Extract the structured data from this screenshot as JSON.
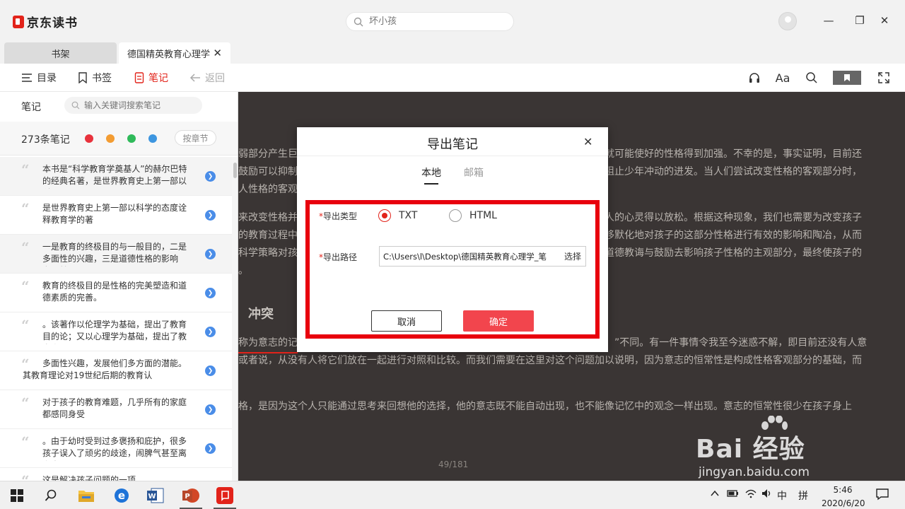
{
  "app": {
    "name": "京东读书",
    "search_placeholder": "坏小孩"
  },
  "window_controls": {
    "minimize": "—",
    "restore": "❐",
    "close": "✕"
  },
  "tabs": [
    {
      "label": "书架"
    },
    {
      "label": "德国精英教育心理学"
    }
  ],
  "toolbar": {
    "toc": "目录",
    "bookmark": "书签",
    "notes": "笔记",
    "back": "返回",
    "font_label": "Aa"
  },
  "sidebar": {
    "title": "笔记",
    "search_placeholder": "输入关键词搜索笔记",
    "count": "273条笔记",
    "chapter_button": "按章节",
    "dot_colors": [
      "#e8323c",
      "#f39c32",
      "#2fba5a",
      "#3d96e0"
    ],
    "notes": [
      {
        "text": "本书是“科学教育学奠基人”的赫尔巴特的经典名著，是世界教育史上第一部以科…",
        "highlight": true,
        "wide": false
      },
      {
        "text": "是世界教育史上第一部以科学的态度诠释教育学的著",
        "highlight": false,
        "wide": false
      },
      {
        "text": "一是教育的终极目的与一般目的，二是多面性的兴趣，三是道德性格的影响力。其…",
        "highlight": true,
        "wide": false
      },
      {
        "text": "教育的终极目的是性格的完美塑造和道德素质的完善。",
        "highlight": false,
        "wide": false
      },
      {
        "text": "。该著作以伦理学为基础，提出了教育目的论；又以心理学为基础，提出了教育方…",
        "highlight": false,
        "wide": false
      },
      {
        "text": "多面性兴趣，发展他们多方面的潜能。其教育理论对19世纪后期的教育认",
        "highlight": false,
        "wide": true
      },
      {
        "text": "对于孩子的教育难题，几乎所有的家庭都感同身受",
        "highlight": false,
        "wide": false
      },
      {
        "text": "。由于幼时受到过多褒扬和庇护，很多孩子误入了顽劣的歧途，闹脾气甚至离家出…",
        "highlight": false,
        "wide": false
      },
      {
        "text": "这是解决孩子问题的一项…",
        "highlight": false,
        "wide": false
      }
    ]
  },
  "reader": {
    "lines": [
      "弱部分产生巨",
      "就可能使好的性格得到加强。不幸的是，事实证明，目前还",
      "鼓励可以抑制",
      "阻止少年冲动的进发。当人们尝试改变性格的客观部分时，",
      "人性格的客观",
      "来改变性格并",
      "人的心灵得以放松。根据这种现象，我们也需要为改变孩子",
      "的教育过程中",
      "移默化地对孩子的这部分性格进行有效的影响和陶冶，从而",
      "科学策略对孩",
      "道德教诲与鼓励去影响孩子性格的主观部分，最终使孩子的",
      "。",
      "称为意志的记",
      "”不同。有一件事情令我至今迷惑不解，即目前还没有人意",
      "或者说，从没有人将它们放在一起进行对照和比较。而我们需要在这里对这个问题加以说明，因为意志的恒常性是构成性格客观部分的基础，而",
      "格，是因为这个人只能通过思考来回想他的选择，他的意志既不能自动出现，也不能像记忆中的观念一样出现。意志的恒常性很少在孩子身上"
    ],
    "heading": "冲突",
    "page": "49/181"
  },
  "dialog": {
    "title": "导出笔记",
    "tab_local": "本地",
    "tab_email": "邮箱",
    "type_label": "导出类型",
    "type_options": [
      "TXT",
      "HTML"
    ],
    "selected_type": "TXT",
    "path_label": "导出路径",
    "path_value": "C:\\Users\\l\\Desktop\\德国精英教育心理学_笔",
    "choose": "选择",
    "cancel": "取消",
    "confirm": "确定",
    "required_mark": "*"
  },
  "taskbar": {
    "ime_lang": "中",
    "ime_mode": "拼",
    "time": "5:46",
    "date": "2020/6/20"
  },
  "watermark": {
    "main": "Bai 经验",
    "sub": "jingyan.baidu.com"
  }
}
